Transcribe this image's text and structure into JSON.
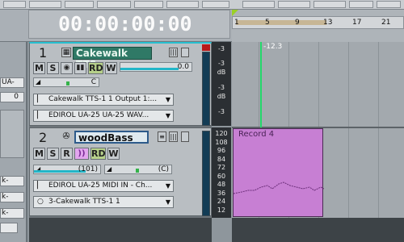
{
  "time_display": "00:00:00:00",
  "ruler": {
    "marker_label": "1",
    "ticks": [
      "1",
      "5",
      "9",
      "13",
      "17",
      "21"
    ]
  },
  "now_label": "-12.3",
  "left_panel": {
    "items": [
      "UA-",
      "0",
      "k-",
      "k-",
      "k-"
    ]
  },
  "tracks": [
    {
      "number": "1",
      "name": "Cakewalk TTS",
      "volume_value": "0.0",
      "pan_value": "C",
      "output": "Cakewalk TTS-1 1 Output 1:...",
      "input": "EDIROL UA-25 UA-25 WAV...",
      "buttons": [
        "M",
        "S",
        "RD",
        "W"
      ],
      "meter_scale": [
        "-3",
        "-3",
        "dB",
        "-3",
        "dB",
        "-3"
      ]
    },
    {
      "number": "2",
      "name": "woodBass",
      "volume_value": "(101)",
      "pan_value": "(C)",
      "input": "EDIROL UA-25 MIDI IN - Ch...",
      "output": "3-Cakewalk TTS-1 1",
      "buttons": [
        "M",
        "S",
        "R",
        "RD",
        "W"
      ],
      "meter_scale": [
        "120",
        "108",
        "96",
        "84",
        "72",
        "60",
        "48",
        "36",
        "24",
        "12"
      ]
    }
  ],
  "clip": {
    "name": "Record 4",
    "color": "#c77fd3"
  },
  "colors": {
    "accent_cyan": "#22b6c8",
    "record_green": "#b6d08a",
    "meter_red": "#b81a1a"
  }
}
